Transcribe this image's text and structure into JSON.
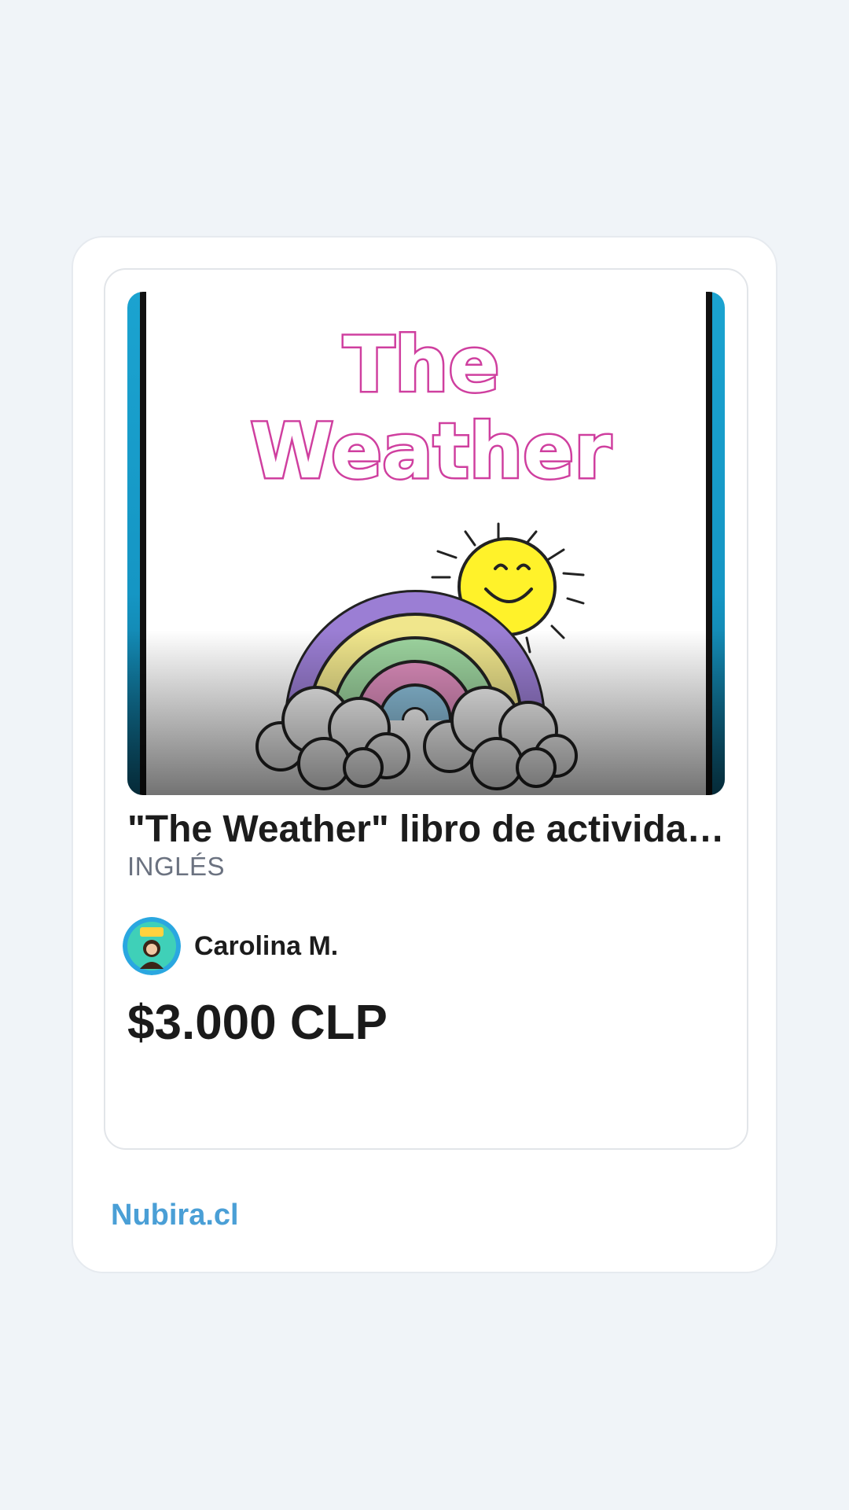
{
  "product": {
    "cover_title_line1": "The",
    "cover_title_line2": "Weather",
    "title": "\"The Weather\" libro de actividades",
    "category": "INGLÉS",
    "seller_name": "Carolina M.",
    "price": "$3.000 CLP"
  },
  "footer": {
    "brand_link": "Nubira.cl"
  },
  "colors": {
    "page_background": "#f0f4f8",
    "brand_link": "#4a9fd6",
    "cover_title": "#cf3f9f",
    "cover_side_bars": "#1ba3d0"
  }
}
